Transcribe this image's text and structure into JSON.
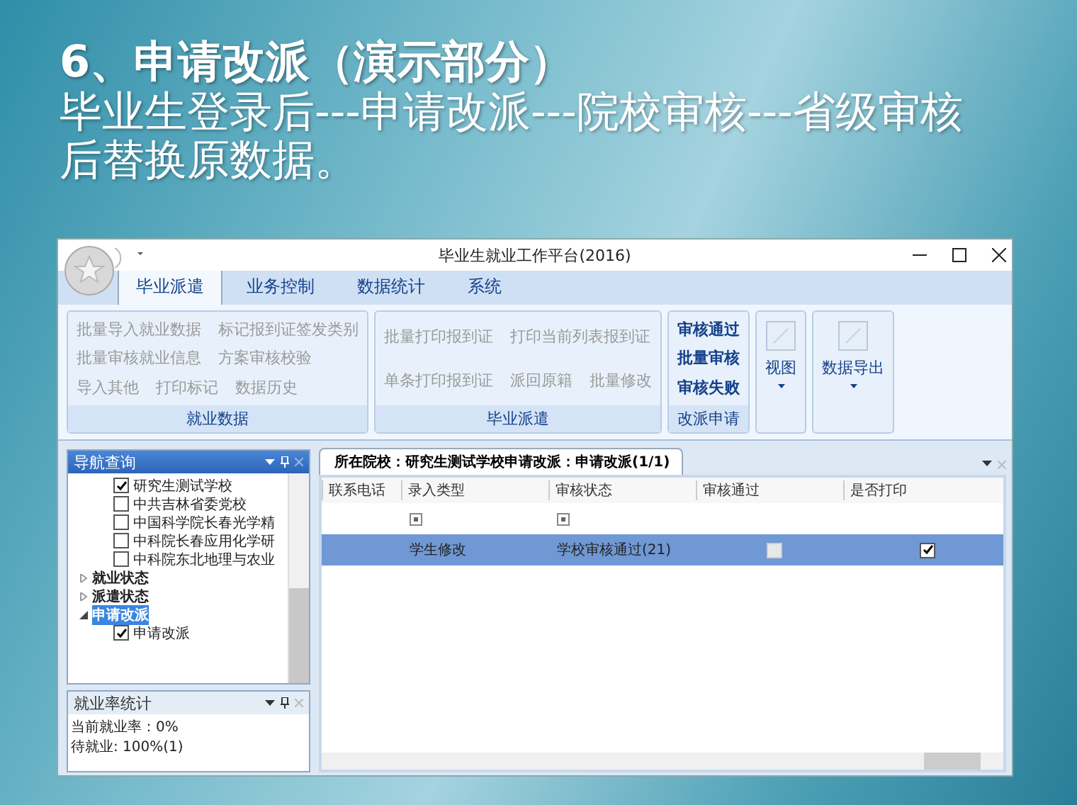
{
  "slide": {
    "title": "6、申请改派（演示部分）",
    "subtitle": [
      "毕业生登录后---申请改派---院校审核---省级审核",
      "后替换原数据。"
    ]
  },
  "window": {
    "title": "毕业生就业工作平台(2016)"
  },
  "tabs": [
    {
      "label": "毕业派遣",
      "selected": true
    },
    {
      "label": "业务控制",
      "selected": false
    },
    {
      "label": "数据统计",
      "selected": false
    },
    {
      "label": "系统",
      "selected": false
    }
  ],
  "ribbon": [
    {
      "kind": "rows",
      "label": "就业数据",
      "lines": [
        {
          "buttons": [
            {
              "label": "批量导入就业数据",
              "disabled": true
            },
            {
              "label": "标记报到证签发类别",
              "disabled": true
            }
          ]
        },
        {
          "buttons": [
            {
              "label": "批量审核就业信息",
              "disabled": true
            },
            {
              "label": "方案审核校验",
              "disabled": true
            }
          ]
        },
        {
          "buttons": [
            {
              "label": "导入其他",
              "disabled": true
            },
            {
              "label": "打印标记",
              "disabled": true
            },
            {
              "label": "数据历史",
              "disabled": true
            }
          ]
        }
      ]
    },
    {
      "kind": "rows",
      "label": "毕业派遣",
      "lines": [
        {
          "buttons": [
            {
              "label": "批量打印报到证",
              "disabled": true
            },
            {
              "label": "打印当前列表报到证",
              "disabled": true
            }
          ]
        },
        {
          "buttons": [
            {
              "label": "单条打印报到证",
              "disabled": true
            },
            {
              "label": "派回原籍",
              "disabled": true
            },
            {
              "label": "批量修改",
              "disabled": true
            }
          ]
        }
      ]
    },
    {
      "kind": "rows",
      "label": "改派申请",
      "lines": [
        {
          "buttons": [
            {
              "label": "审核通过",
              "disabled": false
            }
          ]
        },
        {
          "buttons": [
            {
              "label": "批量审核",
              "disabled": false
            }
          ]
        },
        {
          "buttons": [
            {
              "label": "审核失败",
              "disabled": false
            }
          ]
        }
      ]
    },
    {
      "kind": "big",
      "label": "视图"
    },
    {
      "kind": "big",
      "label": "数据导出"
    }
  ],
  "nav": {
    "title": "导航查询",
    "tree": [
      {
        "children": [
          {
            "label": "研究生测试学校",
            "checked": true
          },
          {
            "label": "中共吉林省委党校",
            "checked": false
          },
          {
            "label": "中国科学院长春光学精",
            "checked": false
          },
          {
            "label": "中科院长春应用化学研",
            "checked": false
          },
          {
            "label": "中科院东北地理与农业",
            "checked": false
          }
        ]
      },
      {
        "label": "就业状态",
        "expanded": false,
        "selected": false
      },
      {
        "label": "派遣状态",
        "expanded": false,
        "selected": false
      },
      {
        "label": "申请改派",
        "expanded": true,
        "selected": true,
        "children": [
          {
            "label": "申请改派",
            "checked": true
          }
        ]
      }
    ]
  },
  "stats": {
    "title": "就业率统计",
    "lines": [
      "当前就业率：0%",
      "待就业: 100%(1)"
    ]
  },
  "document": {
    "tab": "所在院校：研究生测试学校申请改派：申请改派(1/1)",
    "columns": [
      "联系电话",
      "录入类型",
      "审核状态",
      "审核通过",
      "是否打印"
    ],
    "filter_row": [
      {
        "kind": "empty"
      },
      {
        "kind": "filter"
      },
      {
        "kind": "filter"
      },
      {
        "kind": "empty"
      },
      {
        "kind": "empty"
      }
    ],
    "rows": [
      {
        "selected": true,
        "cells": [
          {
            "kind": "text",
            "text": ""
          },
          {
            "kind": "text",
            "text": "学生修改"
          },
          {
            "kind": "text",
            "text": "学校审核通过(21)"
          },
          {
            "kind": "check",
            "checked": false
          },
          {
            "kind": "check",
            "checked": true
          }
        ]
      }
    ]
  }
}
